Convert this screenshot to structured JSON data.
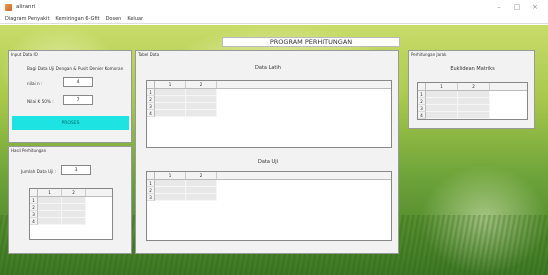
{
  "window": {
    "title": "aliranri",
    "buttons": [
      "–",
      "□",
      "×"
    ]
  },
  "menu": [
    "Diagram Penyakit",
    "Kemiringan 6-Gfit",
    "Dosen",
    "Keluar"
  ],
  "header": {
    "title": "PROGRAM PERHITUNGAN"
  },
  "input_panel": {
    "title": "Input Data IO",
    "subtitle": "Bagi Data Uji Dengan & Pusit Denier Komoran",
    "field1_label": "nilai n :",
    "field1_value": "4",
    "field2_label": "Nilai K 50% :",
    "field2_value": "7",
    "button_label": "PROSES"
  },
  "result_panel": {
    "title": "Hasil Perhitungan",
    "field_label": "Jumlah Data Uji :",
    "field_value": "3",
    "grid": {
      "columns": [
        "1",
        "2"
      ],
      "rows": [
        "1",
        "2",
        "3",
        "4"
      ]
    }
  },
  "table_panel": {
    "title": "Tabel Data",
    "latih": {
      "label": "Data Latih",
      "columns": [
        "1",
        "2"
      ],
      "rows": [
        "1",
        "2",
        "3",
        "4"
      ]
    },
    "uji": {
      "label": "Data Uji",
      "columns": [
        "1",
        "2"
      ],
      "rows": [
        "1",
        "2",
        "3"
      ]
    }
  },
  "right_panel": {
    "title": "Perhitungan Jarak",
    "label": "Euklidean Matriks",
    "grid": {
      "columns": [
        "1",
        "2"
      ],
      "rows": [
        "1",
        "2",
        "3",
        "4"
      ]
    }
  }
}
